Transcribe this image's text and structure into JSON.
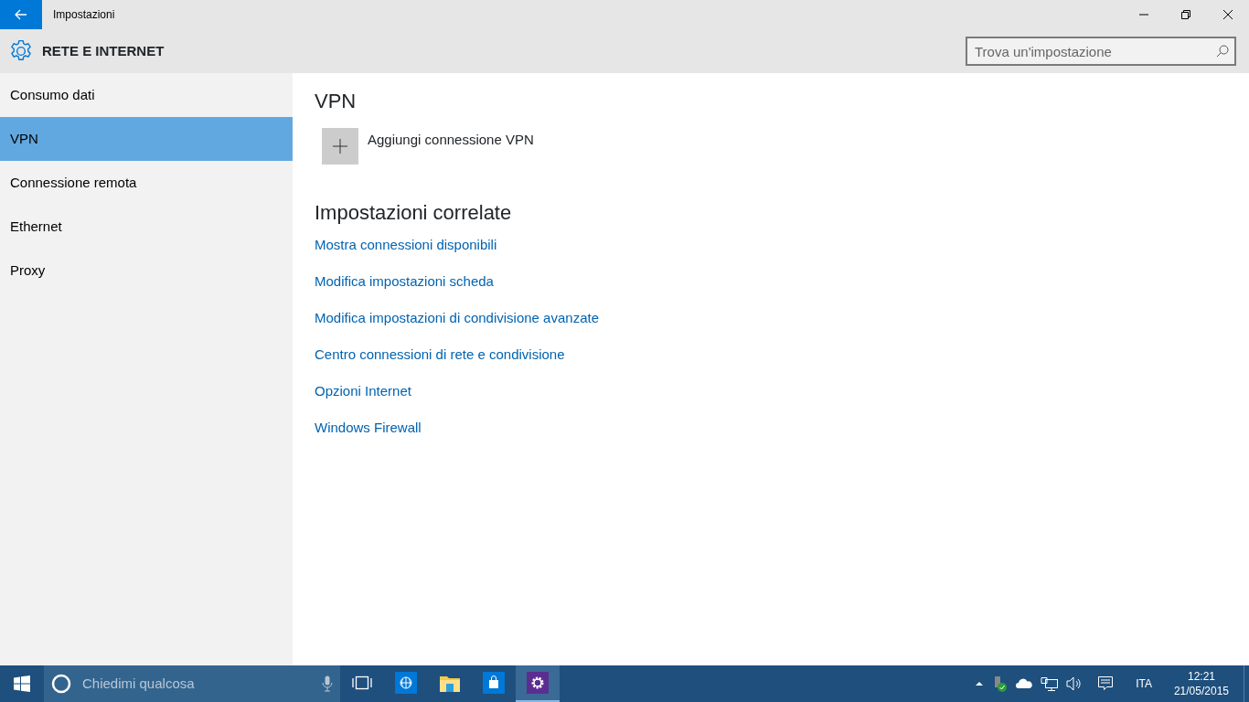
{
  "window": {
    "title": "Impostazioni"
  },
  "header": {
    "title": "RETE E INTERNET",
    "search": {
      "placeholder": "Trova un'impostazione"
    }
  },
  "sidebar": {
    "items": [
      {
        "label": "Consumo dati",
        "selected": false
      },
      {
        "label": "VPN",
        "selected": true
      },
      {
        "label": "Connessione remota",
        "selected": false
      },
      {
        "label": "Ethernet",
        "selected": false
      },
      {
        "label": "Proxy",
        "selected": false
      }
    ]
  },
  "content": {
    "title": "VPN",
    "add_button": {
      "label": "Aggiungi connessione VPN"
    },
    "related": {
      "title": "Impostazioni correlate",
      "links": [
        "Mostra connessioni disponibili",
        "Modifica impostazioni scheda",
        "Modifica impostazioni di condivisione avanzate",
        "Centro connessioni di rete e condivisione",
        "Opzioni Internet",
        "Windows Firewall"
      ]
    }
  },
  "taskbar": {
    "search": {
      "placeholder": "Chiedimi qualcosa"
    },
    "apps": [
      {
        "kind": "globe",
        "selected": false
      },
      {
        "kind": "folder",
        "selected": false
      },
      {
        "kind": "store",
        "selected": false
      },
      {
        "kind": "settings",
        "selected": true
      }
    ],
    "language": "ITA",
    "time": "12:21",
    "date": "21/05/2015"
  }
}
